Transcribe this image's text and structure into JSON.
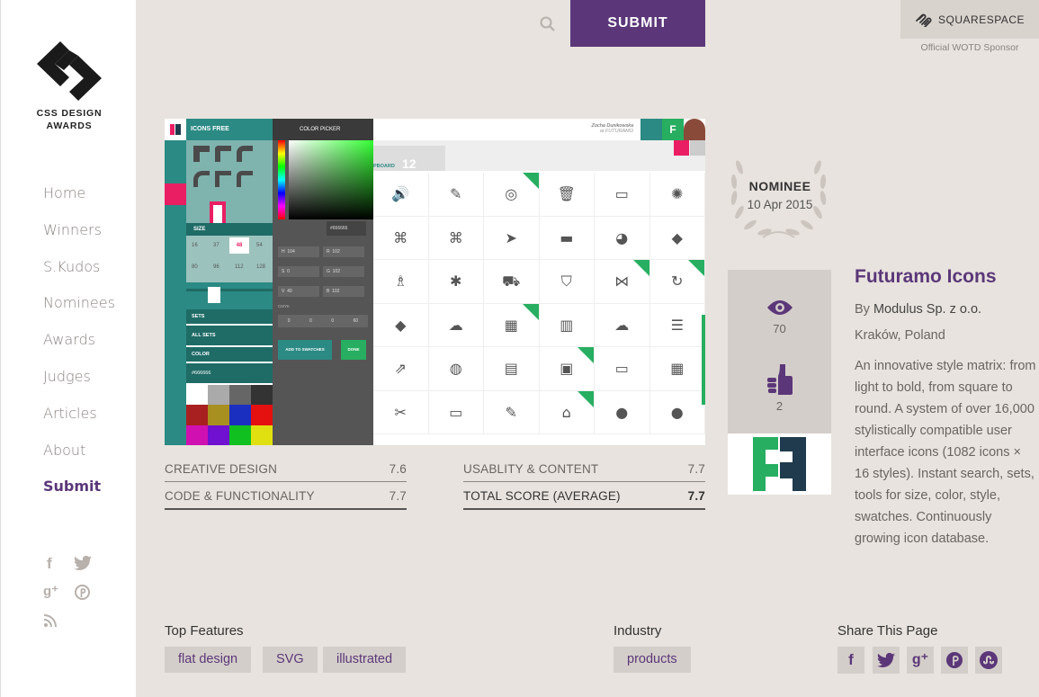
{
  "sidebar": {
    "logo_text_line1": "CSS DESIGN",
    "logo_text_line2": "AWARDS",
    "nav": [
      "Home",
      "Winners",
      "S.Kudos",
      "Nominees",
      "Awards",
      "Judges",
      "Articles",
      "About",
      "Submit"
    ],
    "active_nav": "Submit"
  },
  "header": {
    "submit_label": "SUBMIT",
    "sponsor_name": "SQUARESPACE",
    "sponsor_caption": "Official WOTD Sponsor"
  },
  "preview_app": {
    "app_title": "ICONS FREE",
    "color_picker_label": "COLOR PICKER",
    "user_name": "Zocha Dunikowska",
    "user_org": "at FUTURAMO",
    "user_initial": "F",
    "size_label": "SIZE",
    "sizes": [
      "16",
      "37",
      "48",
      "54",
      "80",
      "96",
      "112",
      "128"
    ],
    "active_size": "48",
    "hex_value": "#666666",
    "color_fields": [
      [
        "H",
        "104"
      ],
      [
        "R",
        "102"
      ],
      [
        "S",
        "0"
      ],
      [
        "G",
        "102"
      ],
      [
        "V",
        "40"
      ],
      [
        "B",
        "102"
      ]
    ],
    "cmyk_label": "CMYK",
    "cmyk_values": [
      "0",
      "0",
      "0",
      "60"
    ],
    "add_swatches": "ADD TO SWATCHES",
    "done_label": "DONE",
    "sets_label": "SETS",
    "all_sets": "ALL SETS",
    "color_label": "COLOR",
    "color_hex": "#666666",
    "clipboard_label": "PBOARD",
    "clipboard_count": "12"
  },
  "scores": {
    "creative_label": "CREATIVE DESIGN",
    "creative_value": "7.6",
    "code_label": "CODE & FUNCTIONALITY",
    "code_value": "7.7",
    "usability_label": "USABLITY & CONTENT",
    "usability_value": "7.7",
    "total_label": "TOTAL SCORE (AVERAGE)",
    "total_value": "7.7"
  },
  "nominee": {
    "title": "NOMINEE",
    "date": "10 Apr 2015"
  },
  "stats": {
    "views": "70",
    "likes": "2"
  },
  "site": {
    "title": "Futuramo Icons",
    "by_prefix": "By",
    "author": "Modulus Sp. z o.o.",
    "location": "Kraków, Poland",
    "description": "An innovative style matrix: from light to bold, from square to round. A system of over 16,000 stylistically compatible user interface icons (1082 icons × 16 styles). Instant search, sets, tools for size, color, style, swatches. Continuously growing icon database."
  },
  "features": {
    "title": "Top Features",
    "tags": [
      "flat design",
      "SVG",
      "illustrated"
    ]
  },
  "industry": {
    "title": "Industry",
    "tags": [
      "products"
    ]
  },
  "share": {
    "title": "Share This Page",
    "icons": [
      "facebook-icon",
      "twitter-icon",
      "google-plus-icon",
      "pinterest-icon",
      "stumbleupon-icon"
    ]
  },
  "colors": {
    "purple": "#5b3779",
    "bg": "#e8e3de",
    "teal": "#2b8a84",
    "green": "#27ae60"
  }
}
